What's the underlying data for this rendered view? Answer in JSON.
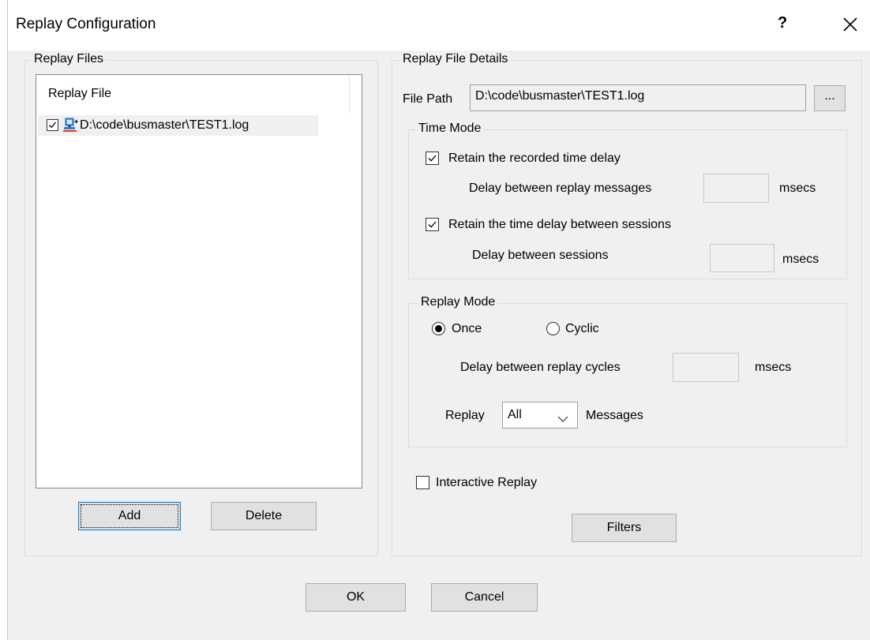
{
  "window": {
    "title": "Replay Configuration",
    "help_label": "?"
  },
  "replay_files": {
    "legend": "Replay Files",
    "column_header": "Replay File",
    "items": [
      {
        "path": "D:\\code\\busmaster\\TEST1.log",
        "checked": true
      }
    ],
    "add_label": "Add",
    "delete_label": "Delete"
  },
  "details": {
    "legend": "Replay File Details",
    "file_path_label": "File Path",
    "file_path_value": "D:\\code\\busmaster\\TEST1.log",
    "browse_label": "...",
    "time_mode": {
      "legend": "Time Mode",
      "retain_recorded_label": "Retain the recorded time delay",
      "retain_recorded_checked": true,
      "delay_messages_label": "Delay between replay messages",
      "delay_messages_value": "",
      "delay_messages_unit": "msecs",
      "retain_sessions_label": "Retain the time delay between sessions",
      "retain_sessions_checked": true,
      "delay_sessions_label": "Delay between sessions",
      "delay_sessions_value": "",
      "delay_sessions_unit": "msecs"
    },
    "replay_mode": {
      "legend": "Replay Mode",
      "once_label": "Once",
      "cyclic_label": "Cyclic",
      "selected": "Once",
      "delay_cycles_label": "Delay between replay cycles",
      "delay_cycles_value": "",
      "delay_cycles_unit": "msecs",
      "replay_label": "Replay",
      "replay_select_value": "All",
      "messages_label": "Messages"
    },
    "interactive_label": "Interactive Replay",
    "interactive_checked": false,
    "filters_label": "Filters"
  },
  "footer": {
    "ok_label": "OK",
    "cancel_label": "Cancel"
  }
}
